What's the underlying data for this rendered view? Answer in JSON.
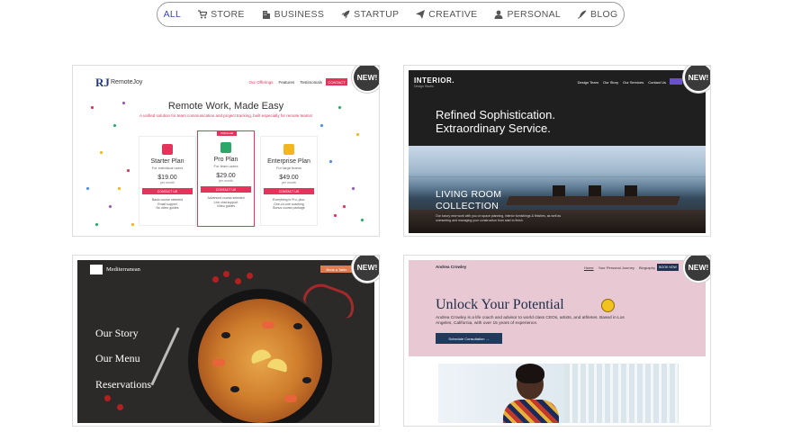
{
  "filters": [
    {
      "label": "ALL",
      "icon": "",
      "active": true
    },
    {
      "label": "STORE",
      "icon": "cart-icon"
    },
    {
      "label": "BUSINESS",
      "icon": "building-icon"
    },
    {
      "label": "STARTUP",
      "icon": "rocket-icon"
    },
    {
      "label": "CREATIVE",
      "icon": "paper-plane-icon"
    },
    {
      "label": "PERSONAL",
      "icon": "user-icon"
    },
    {
      "label": "BLOG",
      "icon": "feather-icon"
    }
  ],
  "badge_label": "NEW!",
  "cards": [
    {
      "id": "remotejoy",
      "brand": "RemoteJoy",
      "logo": "RJ",
      "nav": [
        "Our Offerings",
        "Features",
        "Testimonials"
      ],
      "nav_cta": "CONTACT",
      "title": "Remote Work, Made Easy",
      "subtitle": "A unified solution for team communication and project tracking, built especially for remote teams!",
      "popular_label": "POPULAR",
      "plans": [
        {
          "name": "Starter Plan",
          "for": "For individual users",
          "price": "$19.00",
          "per": "per month",
          "button": "CONTACT US",
          "features": [
            "Basic course selected",
            "Email support",
            "No video guides"
          ],
          "icon_color": "#e6335c"
        },
        {
          "name": "Pro Plan",
          "for": "For team users",
          "price": "$29.00",
          "per": "per month",
          "button": "CONTACT US",
          "features": [
            "Advanced course selected",
            "Live chat support",
            "Video guides"
          ],
          "icon_color": "#2aa86a"
        },
        {
          "name": "Enterprise Plan",
          "for": "For large teams",
          "price": "$49.00",
          "per": "per month",
          "button": "CONTACT US",
          "features": [
            "Everything in Pro, plus:",
            "One-on-one coaching",
            "Bonus course package"
          ],
          "icon_color": "#f2b61e"
        }
      ]
    },
    {
      "id": "interior",
      "brand": "INTERIOR.",
      "brand_sub": "Design Studio",
      "nav": [
        "Design Team",
        "Our Story",
        "Our Services",
        "Contact Us"
      ],
      "headline1": "Refined Sophistication.",
      "headline2": "Extraordinary Service.",
      "section1": "LIVING ROOM",
      "section2": "COLLECTION",
      "desc": "Our luxury new work with you on space planning, interior furnishings & finishes, as well as overseeing and managing your construction from start to finish."
    },
    {
      "id": "mediterranean",
      "brand": "Mediterranean",
      "book_label": "Book a Table",
      "menu": [
        "Our Story",
        "Our Menu",
        "Reservations"
      ]
    },
    {
      "id": "andrea-crowley",
      "brand": "Andrea Crowley",
      "nav": [
        "Home",
        "Your Personal Journey",
        "Biography"
      ],
      "nav_cta": "BOOK NOW",
      "title": "Unlock Your Potential",
      "desc": "Andrea Crowley is a life coach and advisor to world class CEOs, artists, and athletes. Based in Los Angeles, California, with over 15 years of experience.",
      "cta": "Schedule Consultation →"
    }
  ]
}
